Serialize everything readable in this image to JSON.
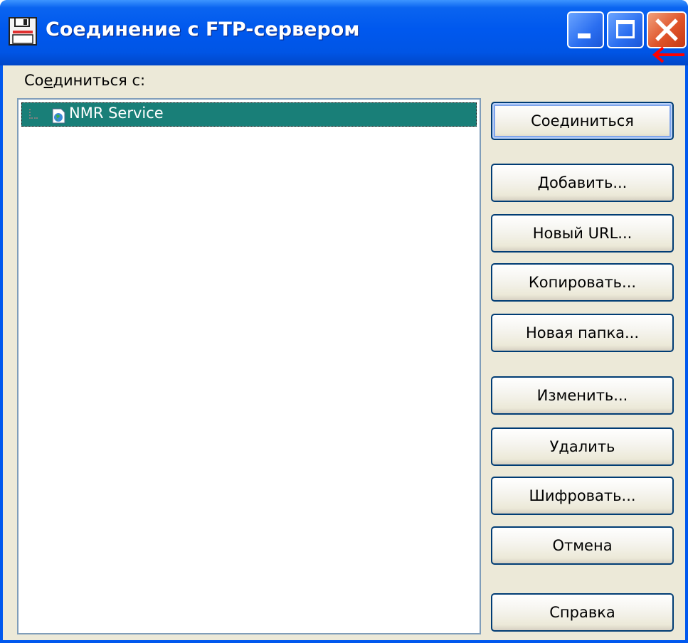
{
  "window": {
    "title": "Соединение с FTP-сервером",
    "title_icon": "floppy-disk-icon",
    "controls": [
      "minimize-icon",
      "maximize-icon",
      "close-icon"
    ]
  },
  "dialog": {
    "connect_to_label_pre": "Со",
    "connect_to_label_u": "е",
    "connect_to_label_post": "диниться с:",
    "tree": {
      "items": [
        {
          "label": "NMR Service",
          "icon": "ftp-site-icon",
          "selected": true
        }
      ]
    },
    "buttons": {
      "connect": "Соединиться",
      "add": "Добавить...",
      "new_url": "Новый URL...",
      "copy": "Копировать...",
      "new_folder": "Новая папка...",
      "edit": "Изменить...",
      "delete": "Удалить",
      "encrypt": "Шифровать...",
      "cancel": "Отмена",
      "help": "Справка"
    }
  },
  "annotation": {
    "icon": "red-arrow-icon",
    "color": "#ff0000"
  },
  "colors": {
    "titlebar": "#0058ee",
    "selection": "#197f78",
    "dialog_bg": "#ece9d8",
    "close_button": "#e0542a"
  }
}
